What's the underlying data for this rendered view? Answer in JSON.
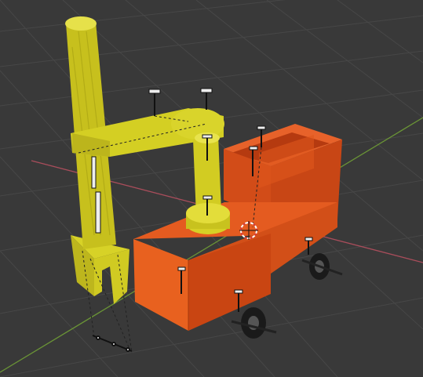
{
  "viewport": {
    "background_color": "#393939",
    "grid_color": "#4a4a4a",
    "x_axis_color": "#b04a5a",
    "y_axis_color": "#6f9a3a"
  },
  "scene": {
    "objects": [
      {
        "name": "robot-arm-column",
        "color": "#c9c21e"
      },
      {
        "name": "robot-arm-upper-link",
        "color": "#d4cf23"
      },
      {
        "name": "robot-arm-lower-link",
        "color": "#d4cf23"
      },
      {
        "name": "robot-arm-gripper",
        "color": "#c9c21e"
      },
      {
        "name": "cart-body",
        "color": "#e0561c"
      },
      {
        "name": "cart-bin",
        "color": "#d84a18"
      },
      {
        "name": "cart-wheels",
        "color": "#222222"
      }
    ],
    "3d_cursor_color": "#ffffff",
    "3d_cursor_accent": "#d63b3b"
  }
}
